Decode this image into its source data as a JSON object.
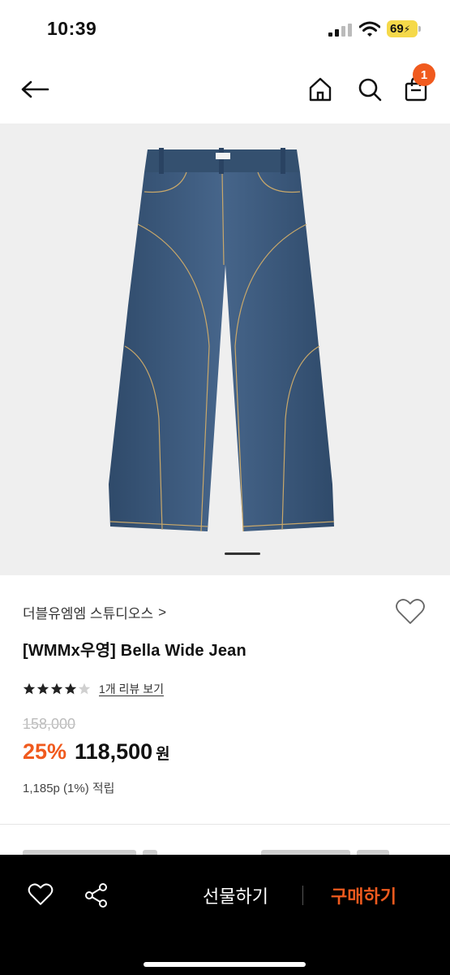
{
  "status_bar": {
    "time": "10:39",
    "battery": "69"
  },
  "nav": {
    "cart_count": "1",
    "icons": [
      "back-arrow-icon",
      "home-icon",
      "search-icon",
      "shopping-bag-icon"
    ]
  },
  "product": {
    "brand": "더블유엠엠 스튜디오스",
    "brand_chevron": ">",
    "name": "[WMMx우영] Bella Wide Jean",
    "rating": 4,
    "rating_max": 5,
    "review_link": "1개 리뷰 보기",
    "original_price": "158,000",
    "discount": "25%",
    "sale_price": "118,500",
    "currency": "원",
    "points": "1,185p (1%) 적립",
    "image_index": 1
  },
  "bottom_bar": {
    "gift_label": "선물하기",
    "buy_label": "구매하기"
  },
  "colors": {
    "accent": "#f05a1e",
    "denim": "#3d5a7c"
  }
}
